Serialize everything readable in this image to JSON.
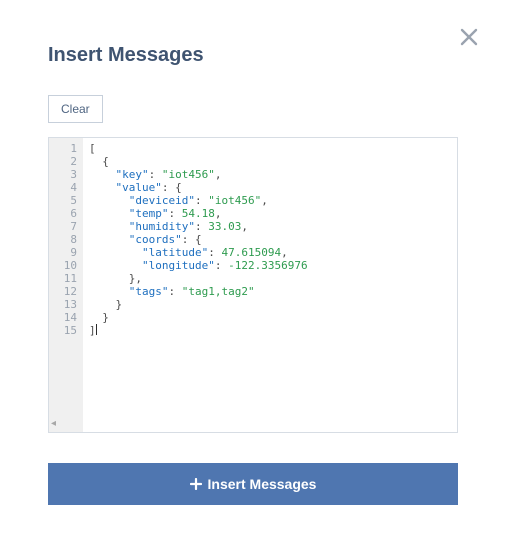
{
  "header": {
    "title": "Insert Messages"
  },
  "toolbar": {
    "clear_label": "Clear"
  },
  "editor": {
    "line_count": 15,
    "content_raw": "[\n  {\n    \"key\": \"iot456\",\n    \"value\": {\n      \"deviceid\": \"iot456\",\n      \"temp\": 54.18,\n      \"humidity\": 33.03,\n      \"coords\": {\n        \"latitude\": 47.615094,\n        \"longitude\": -122.3356976\n      },\n      \"tags\": \"tag1,tag2\"\n    }\n  }\n]",
    "tokens": [
      [
        [
          "punc",
          "["
        ]
      ],
      [
        [
          "indent",
          "  "
        ],
        [
          "punc",
          "{"
        ]
      ],
      [
        [
          "indent",
          "    "
        ],
        [
          "key",
          "\"key\""
        ],
        [
          "punc",
          ": "
        ],
        [
          "str",
          "\"iot456\""
        ],
        [
          "punc",
          ","
        ]
      ],
      [
        [
          "indent",
          "    "
        ],
        [
          "key",
          "\"value\""
        ],
        [
          "punc",
          ": {"
        ]
      ],
      [
        [
          "indent",
          "      "
        ],
        [
          "key",
          "\"deviceid\""
        ],
        [
          "punc",
          ": "
        ],
        [
          "str",
          "\"iot456\""
        ],
        [
          "punc",
          ","
        ]
      ],
      [
        [
          "indent",
          "      "
        ],
        [
          "key",
          "\"temp\""
        ],
        [
          "punc",
          ": "
        ],
        [
          "num",
          "54.18"
        ],
        [
          "punc",
          ","
        ]
      ],
      [
        [
          "indent",
          "      "
        ],
        [
          "key",
          "\"humidity\""
        ],
        [
          "punc",
          ": "
        ],
        [
          "num",
          "33.03"
        ],
        [
          "punc",
          ","
        ]
      ],
      [
        [
          "indent",
          "      "
        ],
        [
          "key",
          "\"coords\""
        ],
        [
          "punc",
          ": {"
        ]
      ],
      [
        [
          "indent",
          "        "
        ],
        [
          "key",
          "\"latitude\""
        ],
        [
          "punc",
          ": "
        ],
        [
          "num",
          "47.615094"
        ],
        [
          "punc",
          ","
        ]
      ],
      [
        [
          "indent",
          "        "
        ],
        [
          "key",
          "\"longitude\""
        ],
        [
          "punc",
          ": "
        ],
        [
          "num",
          "-122.3356976"
        ]
      ],
      [
        [
          "indent",
          "      "
        ],
        [
          "punc",
          "},"
        ]
      ],
      [
        [
          "indent",
          "      "
        ],
        [
          "key",
          "\"tags\""
        ],
        [
          "punc",
          ": "
        ],
        [
          "str",
          "\"tag1,tag2\""
        ]
      ],
      [
        [
          "indent",
          "    "
        ],
        [
          "punc",
          "}"
        ]
      ],
      [
        [
          "indent",
          "  "
        ],
        [
          "punc",
          "}"
        ]
      ],
      [
        [
          "punc",
          "]"
        ],
        [
          "caret",
          ""
        ]
      ]
    ]
  },
  "footer": {
    "insert_label": "Insert Messages"
  },
  "icons": {
    "close": "close-icon",
    "plus": "plus-icon",
    "scroll_left": "scroll-left-icon"
  }
}
